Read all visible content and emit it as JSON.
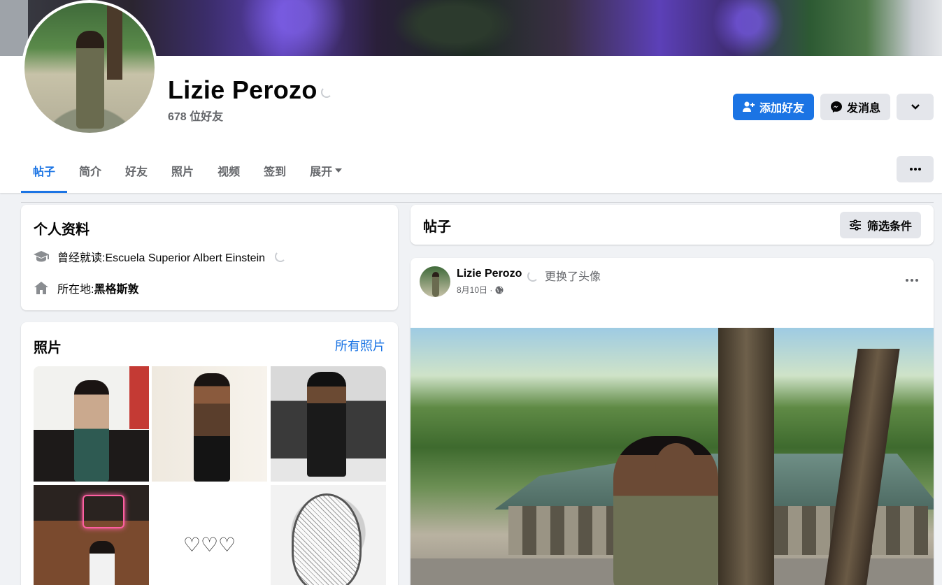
{
  "profile": {
    "name": "Lizie Perozo",
    "friends_count": "678 位好友"
  },
  "actions": {
    "add_friend": "添加好友",
    "message": "发消息"
  },
  "tabs": [
    {
      "label": "帖子",
      "active": true
    },
    {
      "label": "简介"
    },
    {
      "label": "好友"
    },
    {
      "label": "照片"
    },
    {
      "label": "视频"
    },
    {
      "label": "签到"
    },
    {
      "label": "展开"
    }
  ],
  "intro": {
    "title": "个人资料",
    "education_prefix": "曾经就读:",
    "education_value": "Escuela Superior Albert Einstein",
    "location_prefix": "所在地:",
    "location_value": "黑格斯敦"
  },
  "photos": {
    "title": "照片",
    "all_link": "所有照片",
    "hearts": "♡♡♡"
  },
  "posts": {
    "title": "帖子",
    "filter": "筛选条件"
  },
  "post": {
    "author": "Lizie Perozo",
    "action": "更换了头像",
    "date": "8月10日 ·"
  },
  "colors": {
    "accent": "#1b74e4",
    "secondary_button": "#e4e6eb",
    "page_bg": "#f0f2f5"
  },
  "icons": {
    "add_friend": "person-plus-icon",
    "message": "messenger-icon",
    "expand": "chevron-down-icon",
    "more": "ellipsis-icon",
    "education": "graduation-cap-icon",
    "location": "home-icon",
    "filter": "sliders-icon",
    "privacy": "globe-icon"
  }
}
